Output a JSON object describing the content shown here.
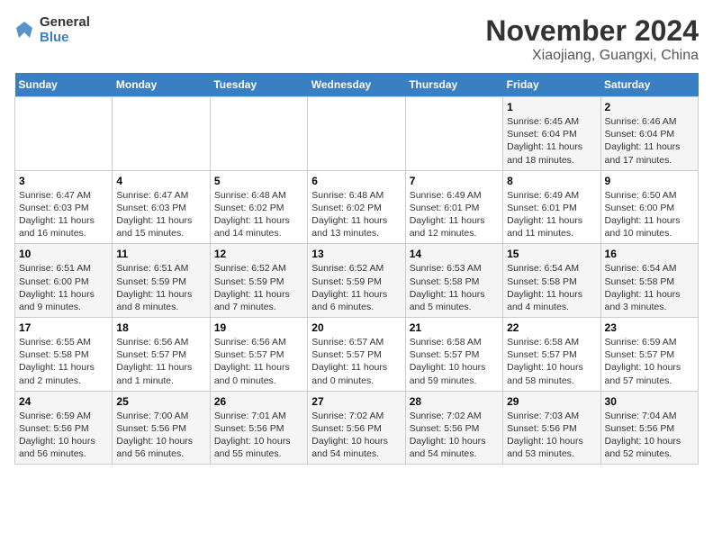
{
  "logo": {
    "line1": "General",
    "line2": "Blue"
  },
  "title": "November 2024",
  "subtitle": "Xiaojiang, Guangxi, China",
  "days_of_week": [
    "Sunday",
    "Monday",
    "Tuesday",
    "Wednesday",
    "Thursday",
    "Friday",
    "Saturday"
  ],
  "weeks": [
    [
      {
        "day": "",
        "info": ""
      },
      {
        "day": "",
        "info": ""
      },
      {
        "day": "",
        "info": ""
      },
      {
        "day": "",
        "info": ""
      },
      {
        "day": "",
        "info": ""
      },
      {
        "day": "1",
        "info": "Sunrise: 6:45 AM\nSunset: 6:04 PM\nDaylight: 11 hours and 18 minutes."
      },
      {
        "day": "2",
        "info": "Sunrise: 6:46 AM\nSunset: 6:04 PM\nDaylight: 11 hours and 17 minutes."
      }
    ],
    [
      {
        "day": "3",
        "info": "Sunrise: 6:47 AM\nSunset: 6:03 PM\nDaylight: 11 hours and 16 minutes."
      },
      {
        "day": "4",
        "info": "Sunrise: 6:47 AM\nSunset: 6:03 PM\nDaylight: 11 hours and 15 minutes."
      },
      {
        "day": "5",
        "info": "Sunrise: 6:48 AM\nSunset: 6:02 PM\nDaylight: 11 hours and 14 minutes."
      },
      {
        "day": "6",
        "info": "Sunrise: 6:48 AM\nSunset: 6:02 PM\nDaylight: 11 hours and 13 minutes."
      },
      {
        "day": "7",
        "info": "Sunrise: 6:49 AM\nSunset: 6:01 PM\nDaylight: 11 hours and 12 minutes."
      },
      {
        "day": "8",
        "info": "Sunrise: 6:49 AM\nSunset: 6:01 PM\nDaylight: 11 hours and 11 minutes."
      },
      {
        "day": "9",
        "info": "Sunrise: 6:50 AM\nSunset: 6:00 PM\nDaylight: 11 hours and 10 minutes."
      }
    ],
    [
      {
        "day": "10",
        "info": "Sunrise: 6:51 AM\nSunset: 6:00 PM\nDaylight: 11 hours and 9 minutes."
      },
      {
        "day": "11",
        "info": "Sunrise: 6:51 AM\nSunset: 5:59 PM\nDaylight: 11 hours and 8 minutes."
      },
      {
        "day": "12",
        "info": "Sunrise: 6:52 AM\nSunset: 5:59 PM\nDaylight: 11 hours and 7 minutes."
      },
      {
        "day": "13",
        "info": "Sunrise: 6:52 AM\nSunset: 5:59 PM\nDaylight: 11 hours and 6 minutes."
      },
      {
        "day": "14",
        "info": "Sunrise: 6:53 AM\nSunset: 5:58 PM\nDaylight: 11 hours and 5 minutes."
      },
      {
        "day": "15",
        "info": "Sunrise: 6:54 AM\nSunset: 5:58 PM\nDaylight: 11 hours and 4 minutes."
      },
      {
        "day": "16",
        "info": "Sunrise: 6:54 AM\nSunset: 5:58 PM\nDaylight: 11 hours and 3 minutes."
      }
    ],
    [
      {
        "day": "17",
        "info": "Sunrise: 6:55 AM\nSunset: 5:58 PM\nDaylight: 11 hours and 2 minutes."
      },
      {
        "day": "18",
        "info": "Sunrise: 6:56 AM\nSunset: 5:57 PM\nDaylight: 11 hours and 1 minute."
      },
      {
        "day": "19",
        "info": "Sunrise: 6:56 AM\nSunset: 5:57 PM\nDaylight: 11 hours and 0 minutes."
      },
      {
        "day": "20",
        "info": "Sunrise: 6:57 AM\nSunset: 5:57 PM\nDaylight: 11 hours and 0 minutes."
      },
      {
        "day": "21",
        "info": "Sunrise: 6:58 AM\nSunset: 5:57 PM\nDaylight: 10 hours and 59 minutes."
      },
      {
        "day": "22",
        "info": "Sunrise: 6:58 AM\nSunset: 5:57 PM\nDaylight: 10 hours and 58 minutes."
      },
      {
        "day": "23",
        "info": "Sunrise: 6:59 AM\nSunset: 5:57 PM\nDaylight: 10 hours and 57 minutes."
      }
    ],
    [
      {
        "day": "24",
        "info": "Sunrise: 6:59 AM\nSunset: 5:56 PM\nDaylight: 10 hours and 56 minutes."
      },
      {
        "day": "25",
        "info": "Sunrise: 7:00 AM\nSunset: 5:56 PM\nDaylight: 10 hours and 56 minutes."
      },
      {
        "day": "26",
        "info": "Sunrise: 7:01 AM\nSunset: 5:56 PM\nDaylight: 10 hours and 55 minutes."
      },
      {
        "day": "27",
        "info": "Sunrise: 7:02 AM\nSunset: 5:56 PM\nDaylight: 10 hours and 54 minutes."
      },
      {
        "day": "28",
        "info": "Sunrise: 7:02 AM\nSunset: 5:56 PM\nDaylight: 10 hours and 54 minutes."
      },
      {
        "day": "29",
        "info": "Sunrise: 7:03 AM\nSunset: 5:56 PM\nDaylight: 10 hours and 53 minutes."
      },
      {
        "day": "30",
        "info": "Sunrise: 7:04 AM\nSunset: 5:56 PM\nDaylight: 10 hours and 52 minutes."
      }
    ]
  ]
}
